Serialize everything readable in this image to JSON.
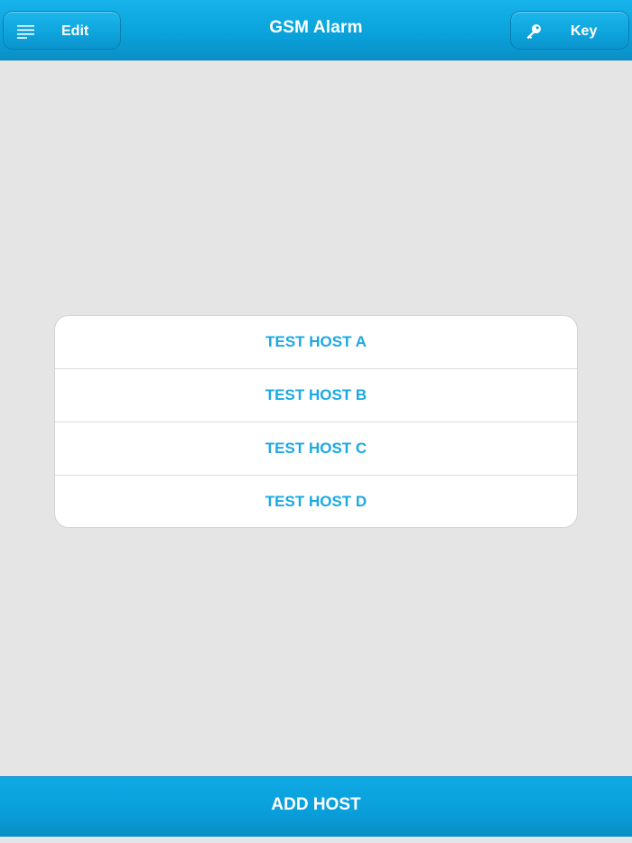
{
  "header": {
    "title": "GSM Alarm",
    "edit_button": {
      "label": "Edit",
      "icon": "menu-icon"
    },
    "key_button": {
      "label": "Key",
      "icon": "key-icon"
    }
  },
  "hosts": [
    {
      "label": "TEST HOST A"
    },
    {
      "label": "TEST HOST B"
    },
    {
      "label": "TEST HOST C"
    },
    {
      "label": "TEST HOST D"
    }
  ],
  "footer": {
    "add_host_label": "ADD HOST"
  },
  "colors": {
    "accent": "#0aa3dc",
    "host_text": "#1aa8e6",
    "background": "#e5e5e5"
  }
}
